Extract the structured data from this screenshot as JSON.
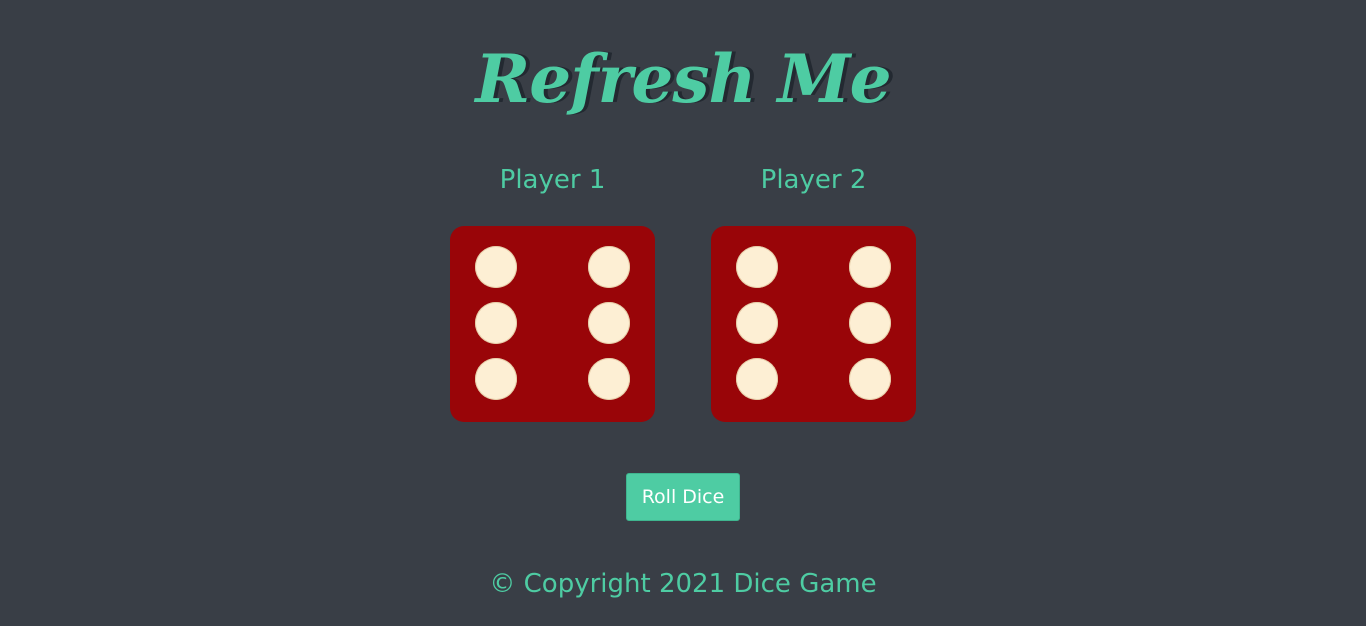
{
  "page": {
    "title": "Refresh Me"
  },
  "players": [
    {
      "label": "Player 1",
      "die_value": 6
    },
    {
      "label": "Player 2",
      "die_value": 6
    }
  ],
  "controls": {
    "roll_label": "Roll Dice"
  },
  "footer": {
    "text": "© Copyright 2021 Dice Game"
  },
  "colors": {
    "background": "#393E46",
    "accent": "#4ECCA3",
    "die": "#990508",
    "pip": "#FDEFD4",
    "title_shadow": "#232931"
  }
}
